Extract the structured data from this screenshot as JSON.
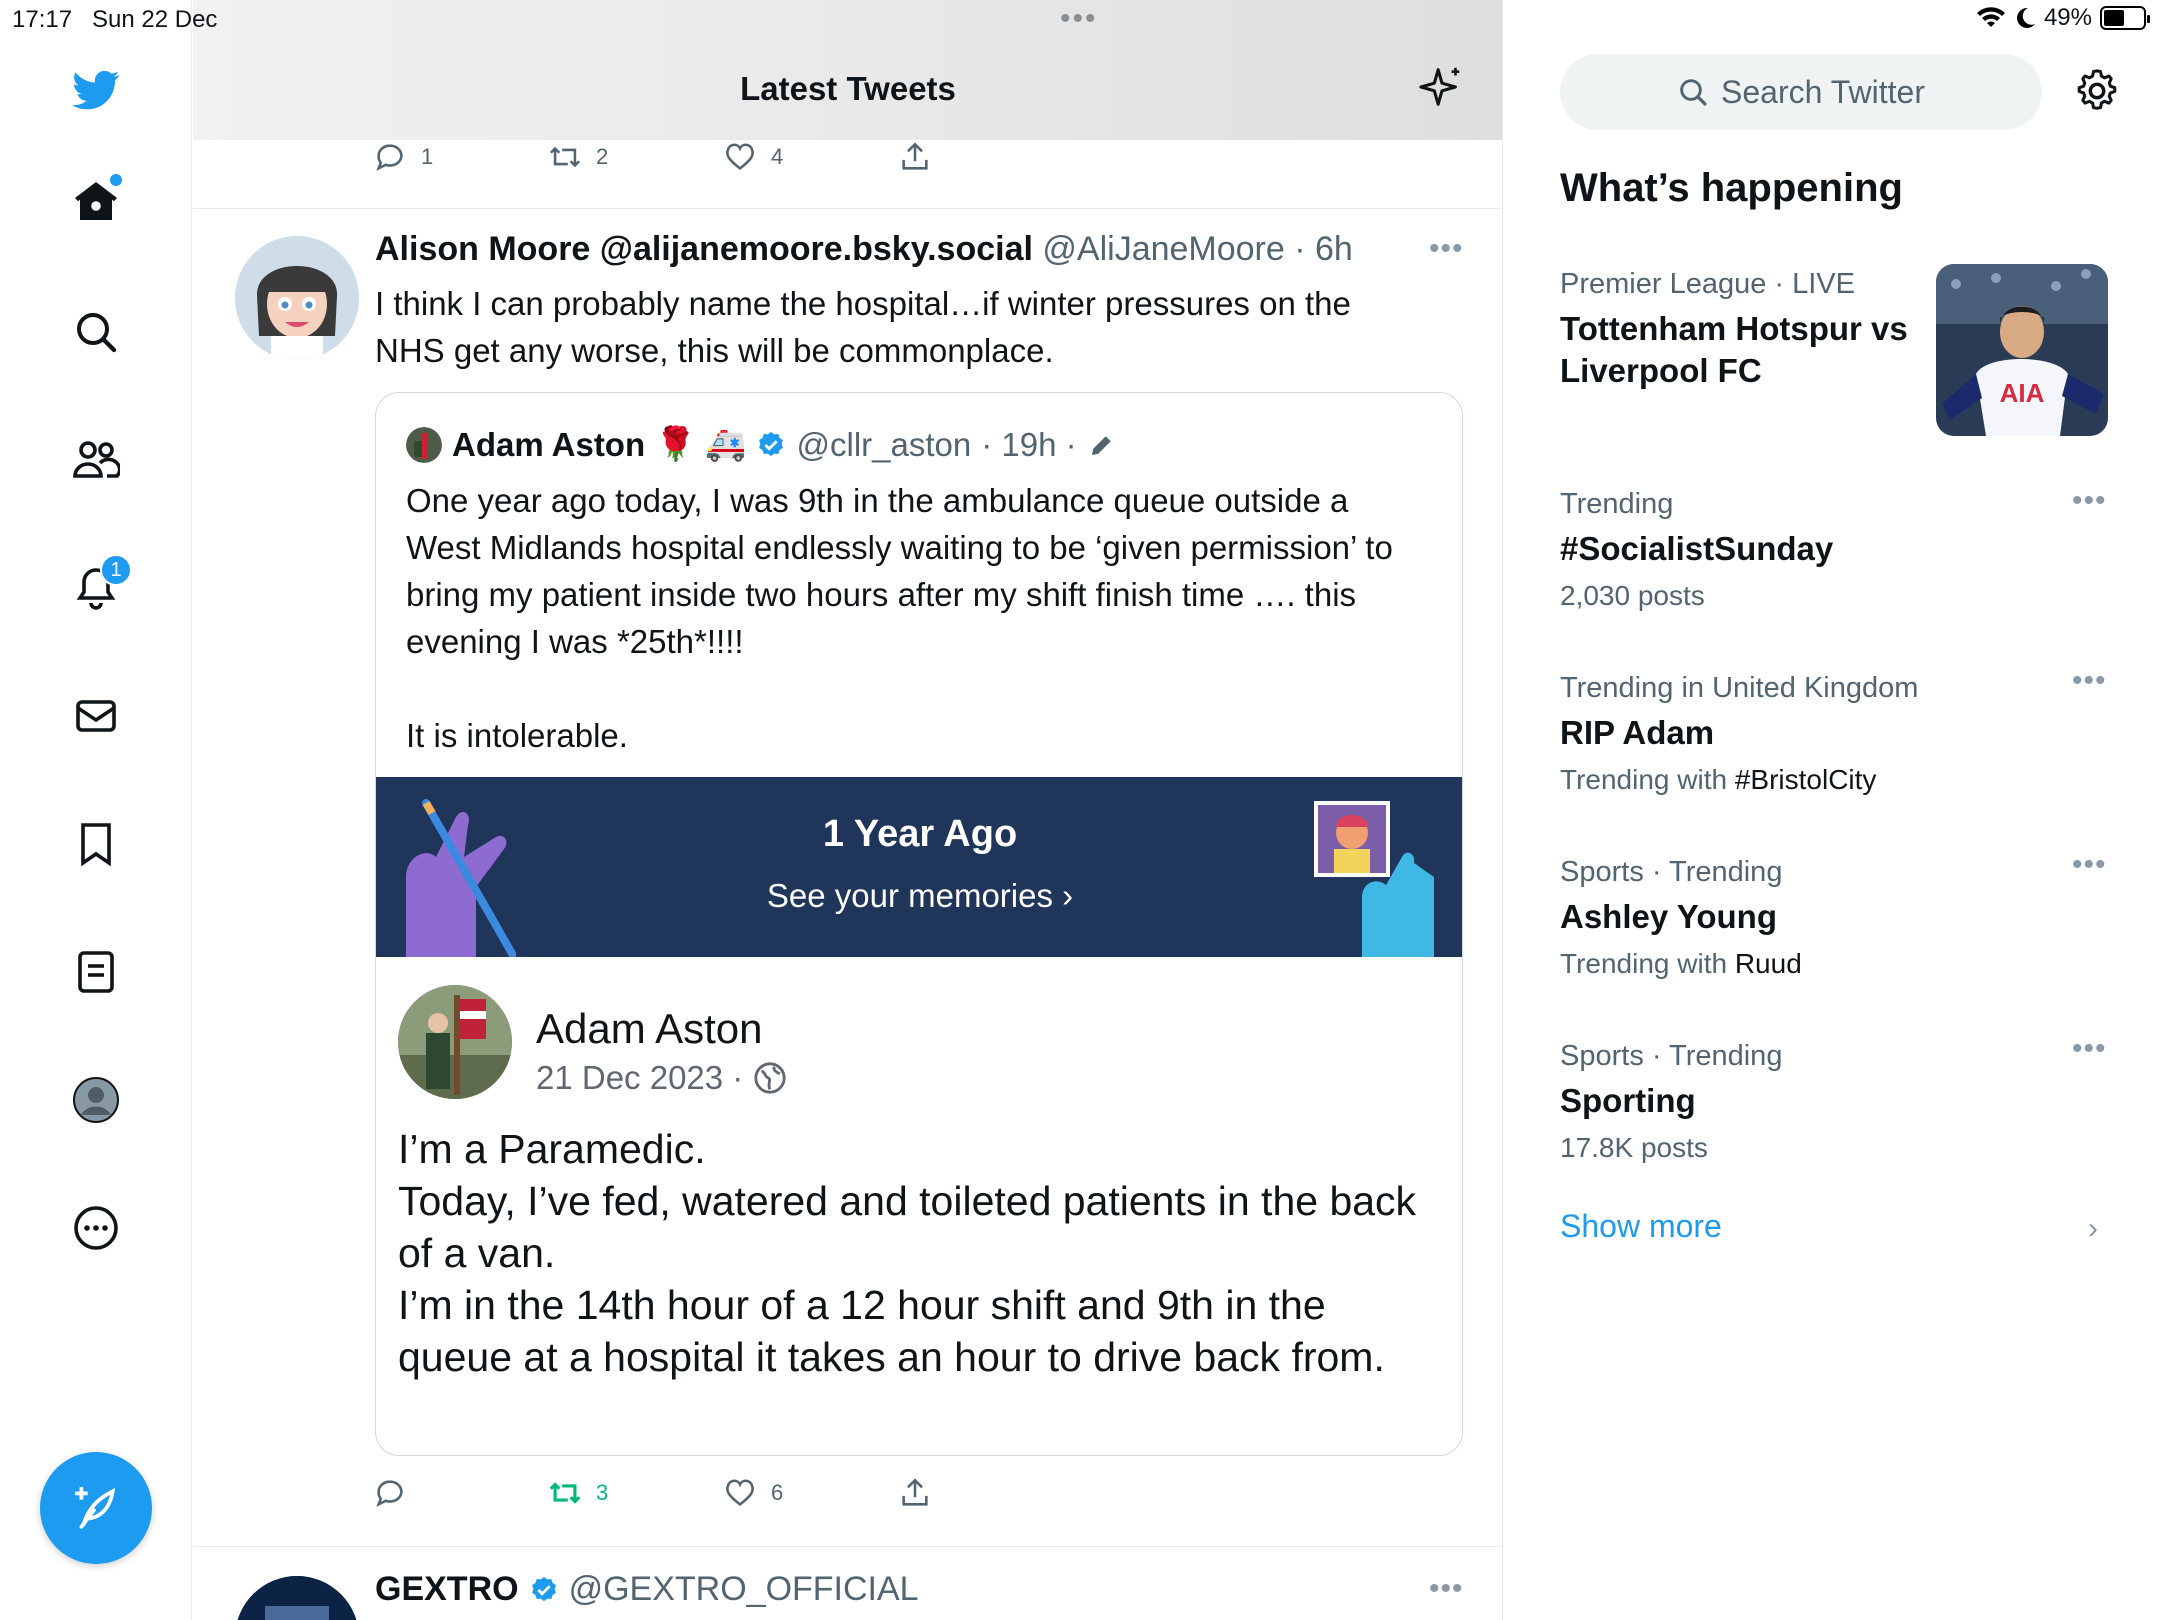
{
  "status": {
    "time": "17:17",
    "date": "Sun 22 Dec",
    "battery": "49%",
    "battery_level": 0.49
  },
  "nav": {
    "notifications_badge": "1"
  },
  "header": {
    "title": "Latest Tweets"
  },
  "prev_tweet_actions": {
    "replies": "1",
    "retweets": "2",
    "likes": "4"
  },
  "tweet": {
    "name": "Alison Moore @alijanemoore.bsky.social",
    "handle": "@AliJaneMoore",
    "time": "· 6h",
    "text": "I think I can probably name the hospital…if winter pressures on the NHS get any worse, this will be commonplace.",
    "quote": {
      "name": "Adam Aston",
      "emoji": "🌹 🚑",
      "handle": "@cllr_aston",
      "time": "· 19h ·",
      "text": "One year ago today, I was 9th in the ambulance queue outside a West Midlands hospital endlessly waiting to be ‘given permission’ to bring my patient inside two hours after my shift finish time …. this evening I was *25th*!!!!\n\nIt is intolerable.",
      "memory_title": "1 Year Ago",
      "memory_sub": "See your memories ›",
      "fb_name": "Adam Aston",
      "fb_date": "21 Dec 2023 ·",
      "fb_text": "I’m a Paramedic.\nToday, I’ve fed, watered and toileted patients in the back of a van.\nI’m in the 14th hour of a 12 hour shift and 9th in the queue at a hospital it takes an hour to drive back from."
    },
    "actions": {
      "replies": "",
      "retweets": "3",
      "likes": "6"
    }
  },
  "tweet2": {
    "name": "GEXTRO",
    "handle": "@GEXTRO_OFFICIAL"
  },
  "sidebar": {
    "search_placeholder": "Search Twitter",
    "section_title": "What’s happening",
    "trends": [
      {
        "meta": "Premier League · LIVE",
        "title": "Tottenham Hotspur vs Liverpool FC"
      },
      {
        "meta": "Trending",
        "title": "#SocialistSunday",
        "sub": "2,030 posts"
      },
      {
        "meta": "Trending in United Kingdom",
        "title": "RIP Adam",
        "sub_prefix": "Trending with ",
        "sub_tag": "#BristolCity"
      },
      {
        "meta": "Sports · Trending",
        "title": "Ashley Young",
        "sub_prefix": "Trending with ",
        "sub_tag": "Ruud"
      },
      {
        "meta": "Sports · Trending",
        "title": "Sporting",
        "sub": "17.8K posts"
      }
    ],
    "show_more": "Show more",
    "image_text": "AIA"
  }
}
